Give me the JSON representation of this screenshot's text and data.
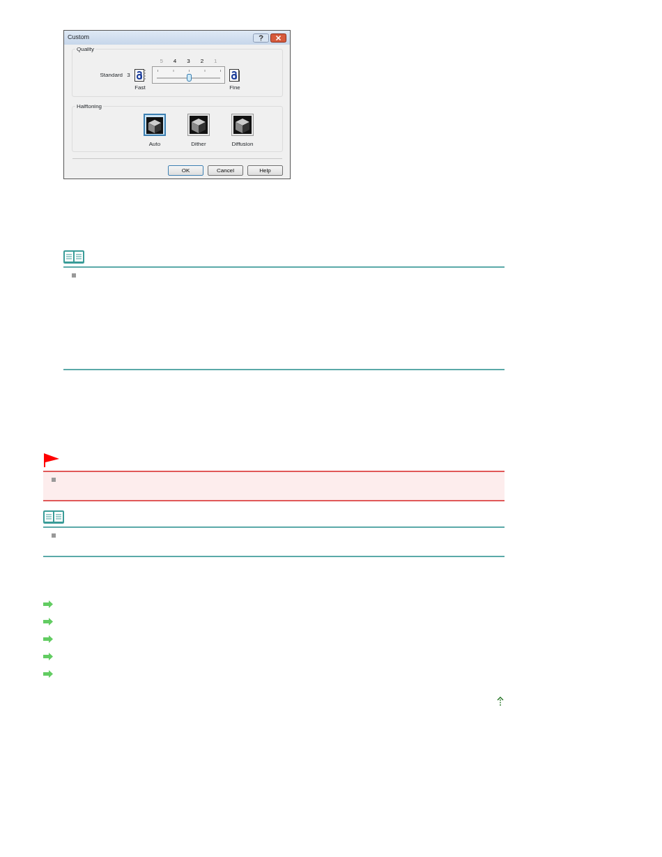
{
  "dialog": {
    "title": "Custom",
    "quality": {
      "legend": "Quality",
      "scale": [
        {
          "label": "5",
          "disabled": true
        },
        {
          "label": "4",
          "disabled": false
        },
        {
          "label": "3",
          "disabled": false
        },
        {
          "label": "2",
          "disabled": false
        },
        {
          "label": "1",
          "disabled": true
        }
      ],
      "setting_label": "Standard",
      "setting_value": "3",
      "left_label": "Fast",
      "right_label": "Fine",
      "slider": {
        "level": 0.5
      }
    },
    "halftoning": {
      "legend": "Halftoning",
      "options": [
        {
          "label": "Auto",
          "selected": true
        },
        {
          "label": "Dither",
          "selected": false
        },
        {
          "label": "Diffusion",
          "selected": false
        }
      ]
    },
    "buttons": [
      {
        "label": "OK",
        "default": true
      },
      {
        "label": "Cancel",
        "default": false
      },
      {
        "label": "Help",
        "default": false
      }
    ]
  },
  "step_note": {
    "kind": "note"
  },
  "sections": [
    {
      "kind": "caution"
    },
    {
      "kind": "note"
    }
  ],
  "links": [
    {
      "kind": "arrow"
    },
    {
      "kind": "arrow"
    },
    {
      "kind": "arrow"
    },
    {
      "kind": "arrow"
    },
    {
      "kind": "arrow"
    }
  ],
  "back_to_top": {
    "kind": "up-arrow"
  }
}
